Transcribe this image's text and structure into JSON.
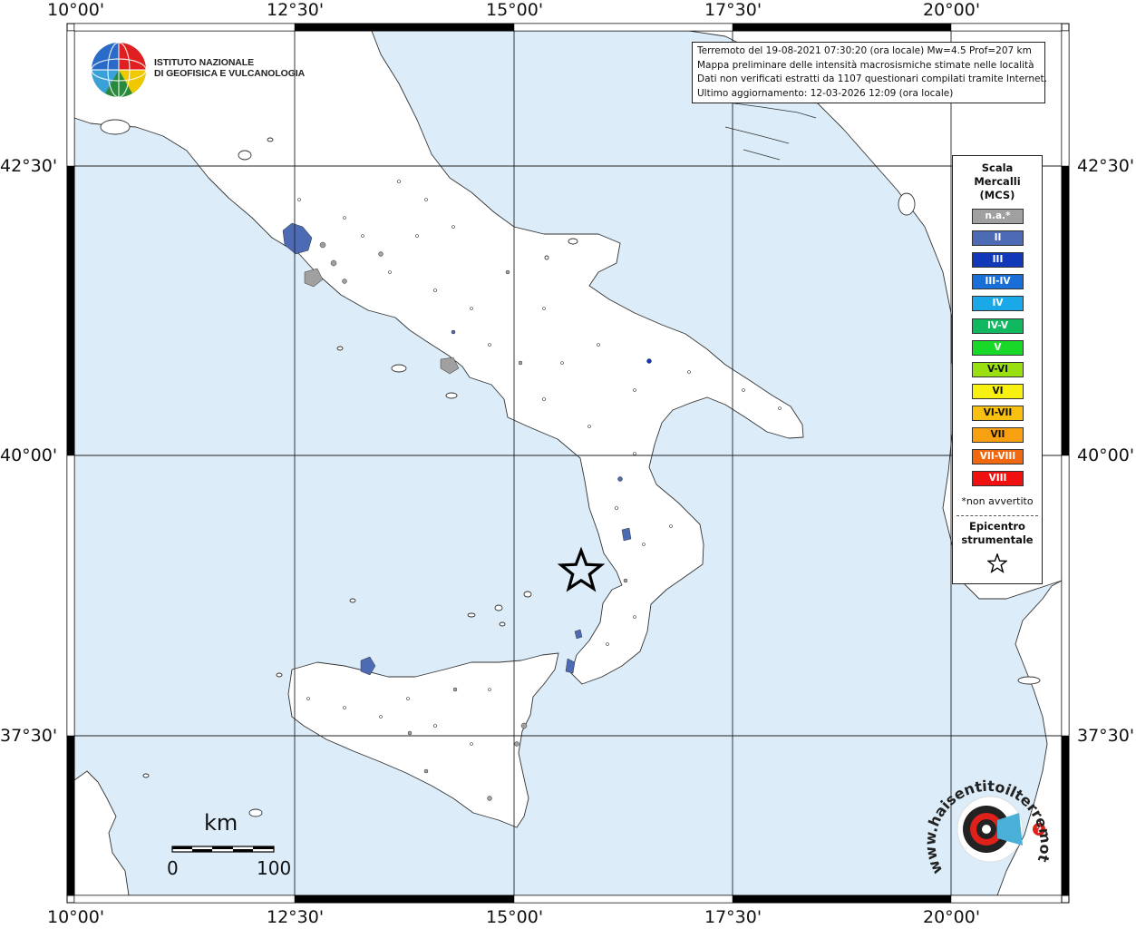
{
  "lon_ticks": [
    "10°00'",
    "12°30'",
    "15°00'",
    "17°30'",
    "20°00'"
  ],
  "lat_ticks": [
    "42°30'",
    "40°00'",
    "37°30'"
  ],
  "info_lines": [
    "Terremoto del 19-08-2021 07:30:20 (ora locale) Mw=4.5 Prof=207 km",
    "Mappa preliminare delle intensità macrosismiche stimate nelle località",
    "Dati non verificati estratti da 1107 questionari compilati tramite Internet.",
    "Ultimo aggiornamento: 12-03-2026 12:09 (ora locale)"
  ],
  "institute": {
    "line1": "ISTITUTO NAZIONALE",
    "line2": "DI GEOFISICA E VULCANOLOGIA"
  },
  "legend": {
    "title_lines": [
      "Scala",
      "Mercalli",
      "(MCS)"
    ],
    "items": [
      {
        "label": "n.a.*",
        "color": "#a0a0a0"
      },
      {
        "label": "II",
        "color": "#4d6ab4"
      },
      {
        "label": "III",
        "color": "#1038b8"
      },
      {
        "label": "III-IV",
        "color": "#1a6ed8"
      },
      {
        "label": "IV",
        "color": "#1aa8e8"
      },
      {
        "label": "IV-V",
        "color": "#10b860"
      },
      {
        "label": "V",
        "color": "#18d828"
      },
      {
        "label": "V-VI",
        "color": "#9ae010"
      },
      {
        "label": "VI",
        "color": "#f8f010"
      },
      {
        "label": "VI-VII",
        "color": "#f8c010"
      },
      {
        "label": "VII",
        "color": "#f8a010"
      },
      {
        "label": "VII-VIII",
        "color": "#f06810"
      },
      {
        "label": "VIII",
        "color": "#f01010"
      }
    ],
    "note": "*non avvertito",
    "epicenter_lines": [
      "Epicentro",
      "strumentale"
    ]
  },
  "scalebar": {
    "unit": "km",
    "start": "0",
    "end": "100"
  },
  "haisentito": {
    "text": "www.haisentitoilterremoto.it"
  },
  "colors": {
    "sea": "#dcedf9",
    "land": "#ffffff",
    "coast": "#333333"
  }
}
